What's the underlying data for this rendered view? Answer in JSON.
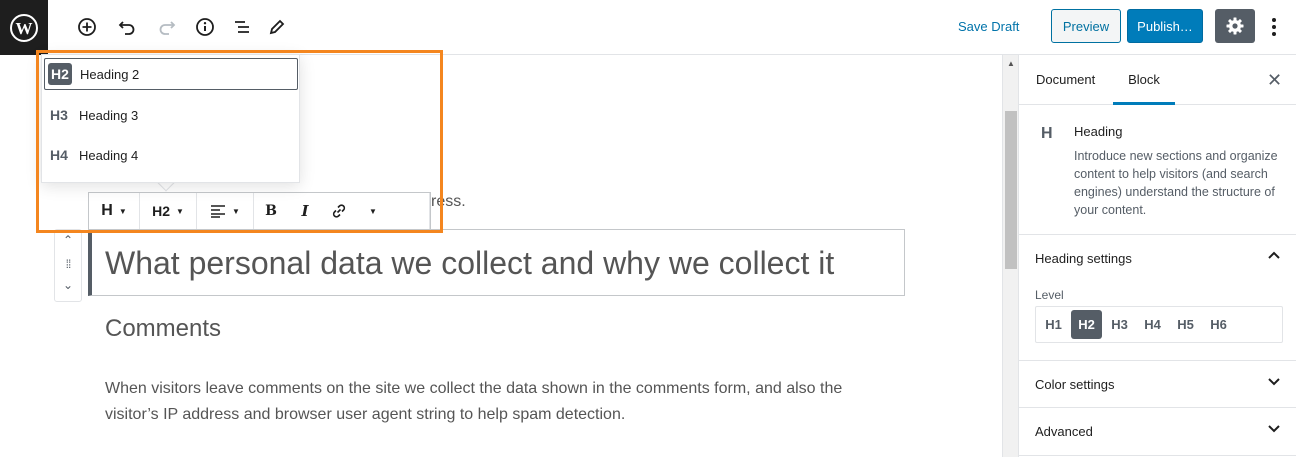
{
  "toolbar": {
    "save_draft": "Save Draft",
    "preview": "Preview",
    "publish": "Publish…",
    "icons": [
      "wordpress-logo",
      "add-block",
      "undo",
      "redo",
      "info",
      "outline",
      "tools",
      "settings",
      "more"
    ]
  },
  "editor": {
    "partial_text": "ress.",
    "heading": "What personal data we collect and why we collect it",
    "subheading": "Comments",
    "paragraph": "When visitors leave comments on the site we collect the data shown in the comments form, and also the visitor’s IP address and browser user agent string to help spam detection."
  },
  "block_toolbar": {
    "block_type": "H",
    "level": "H2"
  },
  "dropdown": {
    "items": [
      {
        "badge": "H2",
        "label": "Heading 2",
        "selected": true
      },
      {
        "badge": "H3",
        "label": "Heading 3",
        "selected": false
      },
      {
        "badge": "H4",
        "label": "Heading 4",
        "selected": false
      }
    ]
  },
  "sidebar": {
    "tabs": [
      "Document",
      "Block"
    ],
    "active_tab": "Block",
    "block_card": {
      "icon": "H",
      "title": "Heading",
      "description": "Introduce new sections and organize content to help visitors (and search engines) understand the structure of your content."
    },
    "heading_settings": {
      "title": "Heading settings",
      "level_label": "Level",
      "levels": [
        "H1",
        "H2",
        "H3",
        "H4",
        "H5",
        "H6"
      ],
      "active_level": "H2"
    },
    "color_settings": "Color settings",
    "advanced": "Advanced"
  },
  "colors": {
    "accent": "#007cba",
    "highlight": "#f4861f",
    "dark": "#1e1e1e",
    "gray": "#555d66"
  }
}
